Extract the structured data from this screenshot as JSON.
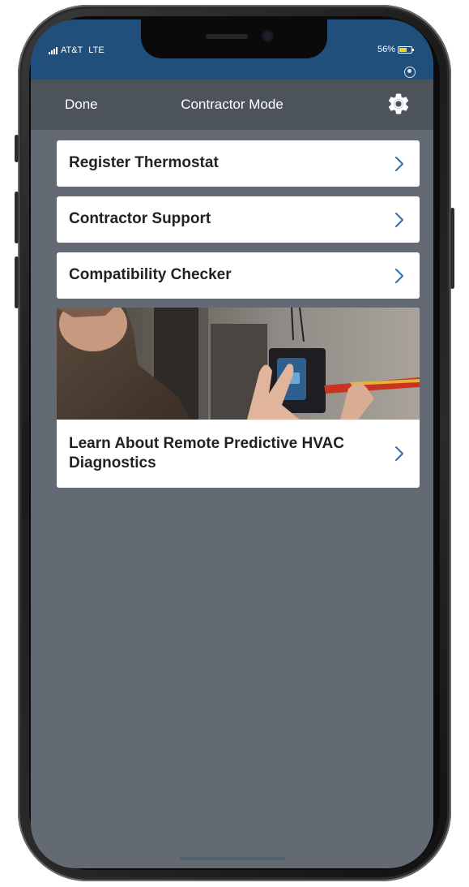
{
  "status_bar": {
    "carrier": "AT&T",
    "network": "LTE",
    "battery_percent": "56%",
    "background_color": "#1f4f7a"
  },
  "nav": {
    "done_label": "Done",
    "title": "Contractor Mode",
    "settings_icon": "gear-icon",
    "background_color": "#4d535b"
  },
  "menu": {
    "items": [
      {
        "label": "Register Thermostat",
        "icon": "chevron-right-icon"
      },
      {
        "label": "Contractor Support",
        "icon": "chevron-right-icon"
      },
      {
        "label": "Compatibility Checker",
        "icon": "chevron-right-icon"
      }
    ]
  },
  "promo": {
    "image": "technician-installing-thermostat-photo",
    "label": "Learn About Remote Predictive HVAC Diagnostics",
    "icon": "chevron-right-icon"
  },
  "colors": {
    "screen_background": "#646a73",
    "chevron": "#2d6db3",
    "card": "#ffffff"
  }
}
